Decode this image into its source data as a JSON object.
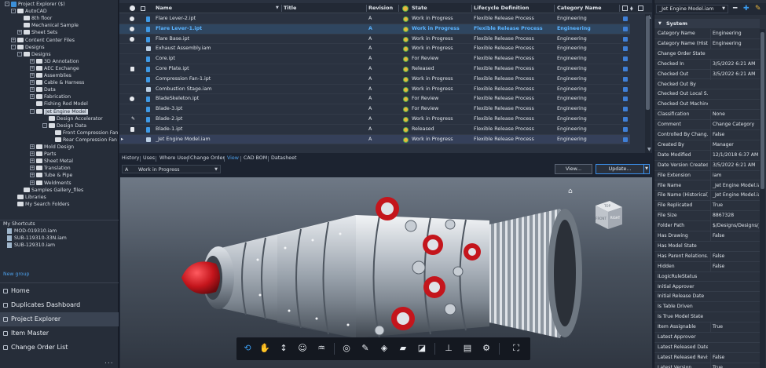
{
  "tree": {
    "items": [
      {
        "label": "Project Explorer ($)",
        "level": 0,
        "toggle": "-",
        "icon": "vault"
      },
      {
        "label": "AutoCAD",
        "level": 1,
        "toggle": "-",
        "icon": "folder"
      },
      {
        "label": "8th floor",
        "level": 2,
        "toggle": "",
        "icon": "folder"
      },
      {
        "label": "Mechanical Sample",
        "level": 2,
        "toggle": "",
        "icon": "folder"
      },
      {
        "label": "Sheet Sets",
        "level": 2,
        "toggle": "+",
        "icon": "folder"
      },
      {
        "label": "Content Center Files",
        "level": 1,
        "toggle": "+",
        "icon": "folder"
      },
      {
        "label": "Designs",
        "level": 1,
        "toggle": "-",
        "icon": "folder"
      },
      {
        "label": "Designs",
        "level": 2,
        "toggle": "-",
        "icon": "folder"
      },
      {
        "label": "3D Annotation",
        "level": 3,
        "toggle": "+",
        "icon": "folder"
      },
      {
        "label": "AEC Exchange",
        "level": 3,
        "toggle": "+",
        "icon": "folder"
      },
      {
        "label": "Assemblies",
        "level": 3,
        "toggle": "+",
        "icon": "folder"
      },
      {
        "label": "Cable & Harness",
        "level": 3,
        "toggle": "+",
        "icon": "folder"
      },
      {
        "label": "Data",
        "level": 3,
        "toggle": "+",
        "icon": "folder"
      },
      {
        "label": "Fabrication",
        "level": 3,
        "toggle": "+",
        "icon": "folder"
      },
      {
        "label": "Fishing Rod Model",
        "level": 3,
        "toggle": "",
        "icon": "folder"
      },
      {
        "label": "Jet Engine Model",
        "level": 3,
        "toggle": "-",
        "icon": "folder",
        "selected": true
      },
      {
        "label": "Design Accelerator",
        "level": 4,
        "toggle": "",
        "icon": "folder"
      },
      {
        "label": "Design Data",
        "level": 4,
        "toggle": "-",
        "icon": "folder"
      },
      {
        "label": "Front Compression Fan",
        "level": 5,
        "toggle": "",
        "icon": "folder"
      },
      {
        "label": "Rear Compression Fan",
        "level": 5,
        "toggle": "",
        "icon": "folder"
      },
      {
        "label": "Mold Design",
        "level": 3,
        "toggle": "+",
        "icon": "folder"
      },
      {
        "label": "Parts",
        "level": 3,
        "toggle": "+",
        "icon": "folder"
      },
      {
        "label": "Sheet Metal",
        "level": 3,
        "toggle": "+",
        "icon": "folder"
      },
      {
        "label": "Translation",
        "level": 3,
        "toggle": "+",
        "icon": "folder"
      },
      {
        "label": "Tube & Pipe",
        "level": 3,
        "toggle": "+",
        "icon": "folder"
      },
      {
        "label": "Weldments",
        "level": 3,
        "toggle": "+",
        "icon": "folder"
      },
      {
        "label": "Samples Gallery_files",
        "level": 2,
        "toggle": "",
        "icon": "folder"
      },
      {
        "label": "Libraries",
        "level": 1,
        "toggle": "",
        "icon": "folder"
      },
      {
        "label": "My Search Folders",
        "level": 1,
        "toggle": "",
        "icon": "folder"
      }
    ]
  },
  "shortcuts": {
    "title": "My Shortcuts",
    "items": [
      "MOD-019310.iam",
      "SUB-119310-33N.iam",
      "SUB-129310.iam"
    ],
    "new_group": "New group"
  },
  "nav": {
    "items": [
      {
        "label": "Home",
        "icon": "home-icon"
      },
      {
        "label": "Duplicates Dashboard",
        "icon": "duplicates-icon"
      },
      {
        "label": "Project Explorer",
        "icon": "project-explorer-icon",
        "active": true
      },
      {
        "label": "Item Master",
        "icon": "item-master-icon"
      },
      {
        "label": "Change Order List",
        "icon": "change-order-icon"
      }
    ],
    "more": "..."
  },
  "grid": {
    "columns": {
      "name": "Name",
      "title": "Title",
      "revision": "Revision",
      "state": "State",
      "lifecycle": "Lifecycle Definition",
      "category": "Category Name"
    },
    "rows": [
      {
        "flag": "dot",
        "icon": "part",
        "name": "Flare Lever-2.ipt",
        "revision": "A",
        "state": "Work in Progress",
        "lifecycle": "Flexible Release Process",
        "category": "Engineering"
      },
      {
        "flag": "dot",
        "icon": "part",
        "name": "Flare Lever-1.ipt",
        "revision": "A",
        "state": "Work in Progress",
        "lifecycle": "Flexible Release Process",
        "category": "Engineering",
        "selected": true
      },
      {
        "flag": "dot",
        "icon": "part",
        "name": "Flare Base.ipt",
        "revision": "A",
        "state": "Work in Progress",
        "lifecycle": "Flexible Release Process",
        "category": "Engineering"
      },
      {
        "flag": "",
        "icon": "assembly",
        "name": "Exhaust Assembly.iam",
        "revision": "A",
        "state": "Work in Progress",
        "lifecycle": "Flexible Release Process",
        "category": "Engineering"
      },
      {
        "flag": "",
        "icon": "part",
        "name": "Core.ipt",
        "revision": "A",
        "state": "For Review",
        "lifecycle": "Flexible Release Process",
        "category": "Engineering"
      },
      {
        "flag": "lock",
        "icon": "part",
        "name": "Core Plate.ipt",
        "revision": "A",
        "state": "Released",
        "lifecycle": "Flexible Release Process",
        "category": "Engineering"
      },
      {
        "flag": "",
        "icon": "part",
        "name": "Compression Fan-1.ipt",
        "revision": "A",
        "state": "Work in Progress",
        "lifecycle": "Flexible Release Process",
        "category": "Engineering"
      },
      {
        "flag": "",
        "icon": "assembly",
        "name": "Combustion Stage.iam",
        "revision": "A",
        "state": "Work in Progress",
        "lifecycle": "Flexible Release Process",
        "category": "Engineering"
      },
      {
        "flag": "dot",
        "icon": "part",
        "name": "BladeSkeleton.ipt",
        "revision": "A",
        "state": "For Review",
        "lifecycle": "Flexible Release Process",
        "category": "Engineering"
      },
      {
        "flag": "",
        "icon": "part",
        "name": "Blade-3.ipt",
        "revision": "A",
        "state": "For Review",
        "lifecycle": "Flexible Release Process",
        "category": "Engineering"
      },
      {
        "flag": "pencil",
        "icon": "part",
        "name": "Blade-2.ipt",
        "revision": "A",
        "state": "Work in Progress",
        "lifecycle": "Flexible Release Process",
        "category": "Engineering"
      },
      {
        "flag": "lock",
        "icon": "part",
        "name": "Blade-1.ipt",
        "revision": "A",
        "state": "Released",
        "lifecycle": "Flexible Release Process",
        "category": "Engineering"
      },
      {
        "flag": "",
        "icon": "assembly",
        "name": "_Jet Engine Model.iam",
        "revision": "A",
        "state": "Work in Progress",
        "lifecycle": "Flexible Release Process",
        "category": "Engineering",
        "current": true
      }
    ]
  },
  "tabs": [
    "History",
    "Uses",
    "Where Used",
    "Change Order",
    "View",
    "CAD BOM",
    "Datasheet"
  ],
  "active_tab": "View",
  "preview": {
    "revision": "A",
    "state": "Work in Progress",
    "view_button": "View...",
    "update_button": "Update...",
    "cube_labels": {
      "top": "TOP",
      "front": "FRONT",
      "right": "RIGHT"
    }
  },
  "toolbar": {
    "tools": [
      "orbit-icon",
      "pan-icon",
      "zoom-icon",
      "walk-icon",
      "look-icon",
      "select-icon",
      "measure-icon",
      "explode-icon",
      "open-folder-icon",
      "section-icon",
      "structure-icon",
      "properties-icon",
      "settings-icon",
      "fullscreen-icon"
    ]
  },
  "properties": {
    "selector": "_Jet Engine Model.iam",
    "section": "System",
    "rows": [
      {
        "name": "Category Name",
        "value": "Engineering"
      },
      {
        "name": "Category Name (Hist...",
        "value": "Engineering"
      },
      {
        "name": "Change Order State",
        "value": ""
      },
      {
        "name": "Checked In",
        "value": "3/5/2022 6:21 AM"
      },
      {
        "name": "Checked Out",
        "value": "3/5/2022 6:21 AM"
      },
      {
        "name": "Checked Out By",
        "value": ""
      },
      {
        "name": "Checked Out Local S...",
        "value": ""
      },
      {
        "name": "Checked Out Machine",
        "value": ""
      },
      {
        "name": "Classification",
        "value": "None"
      },
      {
        "name": "Comment",
        "value": "Change Category"
      },
      {
        "name": "Controlled By Chang...",
        "value": "False"
      },
      {
        "name": "Created By",
        "value": "Manager"
      },
      {
        "name": "Date Modified",
        "value": "12/1/2018 6:37 AM"
      },
      {
        "name": "Date Version Created",
        "value": "3/5/2022 6:21 AM"
      },
      {
        "name": "File Extension",
        "value": "iam"
      },
      {
        "name": "File Name",
        "value": "_Jet Engine Model.iam"
      },
      {
        "name": "File Name (Historical)",
        "value": "_Jet Engine Model.iam"
      },
      {
        "name": "File Replicated",
        "value": "True"
      },
      {
        "name": "File Size",
        "value": "8867328"
      },
      {
        "name": "Folder Path",
        "value": "$/Designs/Designs/Je..."
      },
      {
        "name": "Has Drawing",
        "value": "False"
      },
      {
        "name": "Has Model State",
        "value": ""
      },
      {
        "name": "Has Parent Relations...",
        "value": "False"
      },
      {
        "name": "Hidden",
        "value": "False"
      },
      {
        "name": "iLogicRuleStatus",
        "value": ""
      },
      {
        "name": "Initial Approver",
        "value": ""
      },
      {
        "name": "Initial Release Date",
        "value": ""
      },
      {
        "name": "Is Table Driven",
        "value": ""
      },
      {
        "name": "Is True Model State",
        "value": ""
      },
      {
        "name": "Item Assignable",
        "value": "True"
      },
      {
        "name": "Latest Approver",
        "value": ""
      },
      {
        "name": "Latest Released Date",
        "value": ""
      },
      {
        "name": "Latest Released Revisi...",
        "value": "False"
      },
      {
        "name": "Latest Version",
        "value": "True"
      }
    ]
  },
  "colors": {
    "accent": "#3a9cf0",
    "selection": "#5bb4ff",
    "engine_red": "#c4151c"
  }
}
